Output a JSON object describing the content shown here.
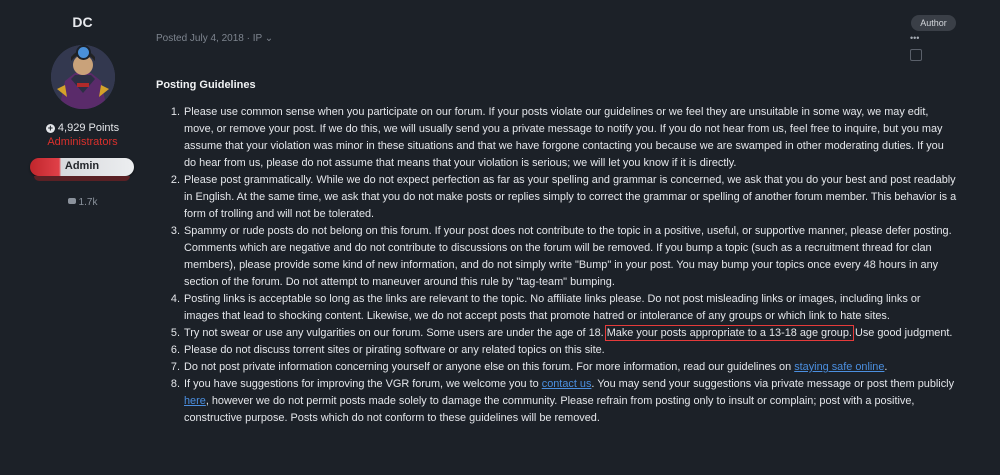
{
  "author": {
    "username": "DC",
    "points": "4,929 Points",
    "group": "Administrators",
    "badge": "Admin",
    "post_count": "1.7k"
  },
  "post": {
    "meta": "Posted July 4, 2018 · IP ⌄",
    "author_tag": "Author",
    "more_icon": "•••",
    "title": "Posting Guidelines"
  },
  "guidelines": [
    {
      "num": "1.",
      "text": "Please use common sense when you participate on our forum.  If your posts violate our guidelines or we feel they are unsuitable in some way, we may edit, move, or remove your post.  If we do this, we will usually send you a private message to notify you.  If you do not hear from us, feel free to inquire, but you may assume that your violation was minor in these situations and that we have forgone contacting you because we are swamped in other moderating duties.  If you do hear from us, please do not assume that means that your violation is serious; we will let you know if it is directly."
    },
    {
      "num": "2.",
      "text": "Please post grammatically.  While we do not expect perfection as far as your spelling and grammar is concerned, we ask that you do your best and post readably in English.  At the same time, we ask that you do not make posts or replies simply to correct the grammar or spelling of another forum member.  This behavior is a form of trolling and will not be tolerated."
    },
    {
      "num": "3.",
      "text": "Spammy or rude posts do not belong on this forum.  If your post does not contribute to the topic in a positive, useful, or supportive manner, please defer posting.  Comments which are negative and do not contribute to discussions on the forum will be removed.  If you bump a topic (such as a recruitment thread for clan members), please provide some kind of new information, and do not simply write \"Bump\" in your post.  You may bump your topics once every 48 hours in any section of the forum.  Do not attempt to maneuver around this rule by \"tag-team\" bumping."
    },
    {
      "num": "4.",
      "text": "Posting links is acceptable so long as the links are relevant to the topic.  No affiliate links please.  Do not post misleading links or images, including links or images that lead to shocking content.  Likewise, we do not accept posts that promote hatred or intolerance of any groups or which link to hate sites."
    },
    {
      "num": "5.",
      "before": "Try not swear or use any vulgarities on our forum.  Some users are under the age of 18. ",
      "highlight": "Make your posts appropriate to a 13-18 age group.",
      "after": " Use good judgment."
    },
    {
      "num": "6.",
      "text": "Please do not discuss torrent sites or pirating software or any related topics on this site."
    },
    {
      "num": "7.",
      "before": "Do not post private information concerning yourself or anyone else on this forum.  For more information, read our guidelines on ",
      "link": "staying safe online",
      "after": "."
    },
    {
      "num": "8.",
      "before": "If you have suggestions for improving the VGR forum, we welcome you to ",
      "link": "contact us",
      "middle": ".  You may send your suggestions via private message or post them publicly ",
      "link2": "here",
      "after": ", however we do not permit posts made solely to damage the community.  Please refrain from posting only to insult or complain; post with a positive, constructive purpose.  Posts which do not conform to these guidelines will be removed."
    }
  ],
  "colors": {
    "background": "#1c2128",
    "group": "#d9302c",
    "link": "#4b8fe0",
    "highlight_box": "#e53b3b"
  },
  "icons": [
    "avatar",
    "online-status-icon",
    "points-plus-icon",
    "comment-icon",
    "more-options-icon",
    "checkbox-icon"
  ]
}
